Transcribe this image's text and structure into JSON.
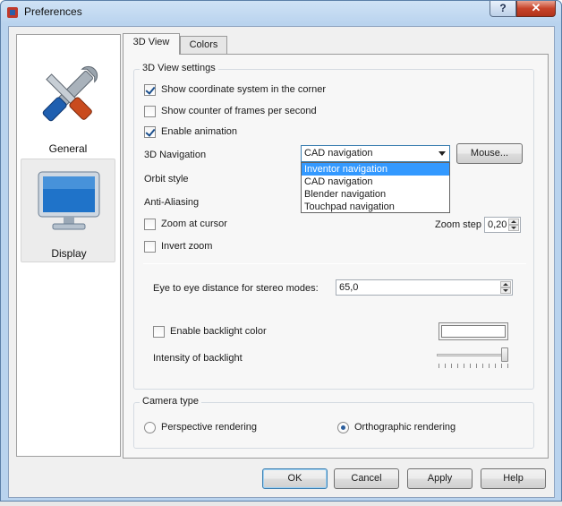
{
  "window": {
    "title": "Preferences",
    "help_label": "?",
    "close_label": "✕"
  },
  "sidebar": {
    "items": [
      {
        "label": "General",
        "icon": "tools-icon"
      },
      {
        "label": "Display",
        "icon": "monitor-icon",
        "selected": true
      }
    ]
  },
  "tabs": [
    {
      "label": "3D View",
      "active": true
    },
    {
      "label": "Colors"
    }
  ],
  "settings_group": {
    "title": "3D View settings",
    "show_coordinate": {
      "label": "Show coordinate system in the corner",
      "checked": true
    },
    "show_counter": {
      "label": "Show counter of frames per second",
      "checked": false
    },
    "enable_animation": {
      "label": "Enable animation",
      "checked": true
    },
    "navigation_label": "3D Navigation",
    "navigation_value": "CAD navigation",
    "navigation_options": [
      "Inventor navigation",
      "CAD navigation",
      "Blender navigation",
      "Touchpad navigation"
    ],
    "mouse_button": "Mouse...",
    "orbit_label": "Orbit style",
    "antialias_label": "Anti-Aliasing",
    "zoom_cursor": {
      "label": "Zoom at cursor",
      "checked": false
    },
    "zoom_step_label": "Zoom step",
    "zoom_step_value": "0,20",
    "invert_zoom": {
      "label": "Invert zoom",
      "checked": false
    },
    "eye_distance_label": "Eye to eye distance for stereo modes:",
    "eye_distance_value": "65,0",
    "backlight": {
      "label": "Enable backlight color",
      "checked": false
    },
    "backlight_intensity_label": "Intensity of backlight",
    "backlight_intensity_level": 1.0
  },
  "camera_group": {
    "title": "Camera type",
    "perspective_label": "Perspective rendering",
    "orthographic_label": "Orthographic rendering",
    "selected": "orthographic"
  },
  "buttons": {
    "ok": "OK",
    "cancel": "Cancel",
    "apply": "Apply",
    "help": "Help"
  },
  "colors": {
    "accent": "#3399ff",
    "title_bar": "#b9d3ee",
    "close": "#c7432a"
  }
}
